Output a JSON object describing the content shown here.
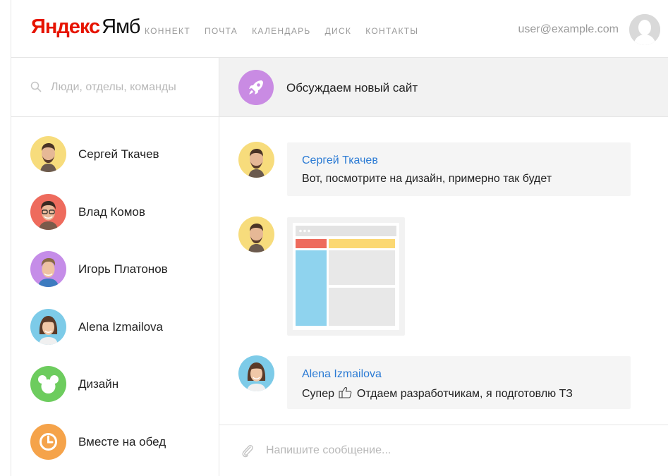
{
  "header": {
    "logo_brand": "Яндекс",
    "logo_product": "Ямб",
    "nav": [
      "КОННЕКТ",
      "ПОЧТА",
      "КАЛЕНДАРЬ",
      "ДИСК",
      "КОНТАКТЫ"
    ],
    "user_email": "user@example.com"
  },
  "sidebar": {
    "search_placeholder": "Люди, отделы, команды",
    "contacts": [
      {
        "name": "Сергей Ткачев",
        "avatar_bg": "#f7dc7c"
      },
      {
        "name": "Влад Комов",
        "avatar_bg": "#ee6b5d"
      },
      {
        "name": "Игорь Платонов",
        "avatar_bg": "#c58de8"
      },
      {
        "name": "Alena Izmailova",
        "avatar_bg": "#7dcbe8"
      },
      {
        "name": "Дизайн",
        "avatar_bg": "#6dcc5e"
      },
      {
        "name": "Вместе на обед",
        "avatar_bg": "#f5a34a"
      }
    ]
  },
  "chat": {
    "title": "Обсуждаем новый сайт",
    "messages": [
      {
        "author": "Сергей Ткачев",
        "text": "Вот, посмотрите на дизайн, примерно так будет"
      },
      {
        "author": "",
        "text": ""
      },
      {
        "author": "Alena Izmailova",
        "text_before": "Супер",
        "text_after": "Отдаем разработчикам, я подготовлю ТЗ"
      }
    ],
    "composer_placeholder": "Напишите сообщение..."
  },
  "colors": {
    "accent_link": "#2a7ad4",
    "brand_red": "#e61400",
    "group_avatar": "#c98be3"
  }
}
